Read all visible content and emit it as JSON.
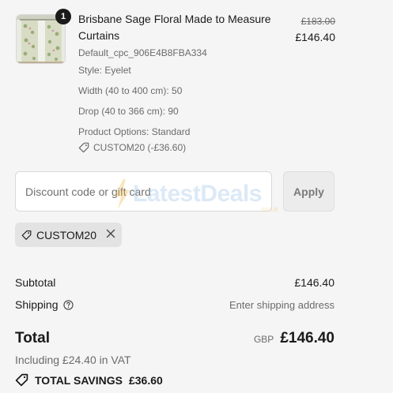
{
  "line_item": {
    "quantity": "1",
    "title": "Brisbane Sage Floral Made to Measure Curtains",
    "sku": "Default_cpc_906E4B8FBA334",
    "style": "Style: Eyelet",
    "width": "Width (40 to 400 cm): 50",
    "drop": "Drop (40 to 366 cm): 90",
    "options": "Product Options: Standard",
    "discount_applied": "CUSTOM20 (-£36.60)",
    "original_price": "£183.00",
    "price": "£146.40",
    "thumbnail_icon": "curtain-product-image"
  },
  "discount": {
    "placeholder": "Discount code or gift card",
    "value": "",
    "apply_label": "Apply"
  },
  "watermark": {
    "text": "LatestDeals",
    "sub": ".co.uk"
  },
  "applied_code": {
    "code": "CUSTOM20",
    "tag_icon": "tag-icon",
    "remove_icon": "close-icon"
  },
  "summary": {
    "subtotal_label": "Subtotal",
    "subtotal_value": "£146.40",
    "shipping_label": "Shipping",
    "shipping_value": "Enter shipping address",
    "total_label": "Total",
    "currency": "GBP",
    "total_value": "£146.40",
    "vat_note": "Including £24.40 in VAT",
    "savings_label": "TOTAL SAVINGS",
    "savings_value": "£36.60"
  },
  "colors": {
    "background": "#f5f5f5",
    "text": "#1a1a1a",
    "muted": "#6b6b6b",
    "badge": "#1a1a1a"
  }
}
